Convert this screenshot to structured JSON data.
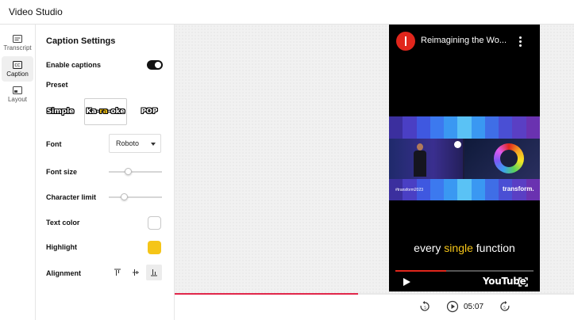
{
  "app": {
    "title": "Video Studio"
  },
  "rail": {
    "items": [
      {
        "label": "Transcript",
        "icon": "transcript-icon",
        "active": false
      },
      {
        "label": "Caption",
        "icon": "closed-caption-icon",
        "active": true
      },
      {
        "label": "Layout",
        "icon": "layout-icon",
        "active": false
      }
    ]
  },
  "panel": {
    "title": "Caption Settings",
    "enable_captions": {
      "label": "Enable captions",
      "on": true
    },
    "preset": {
      "label": "Preset",
      "options": [
        {
          "text": "Simple",
          "selected": false
        },
        {
          "parts": [
            "Ka-",
            "ra",
            "-oke"
          ],
          "selected": true
        },
        {
          "text": "POP",
          "selected": false
        }
      ]
    },
    "font": {
      "label": "Font",
      "value": "Roboto"
    },
    "font_size": {
      "label": "Font size",
      "fraction": 0.35
    },
    "character_limit": {
      "label": "Character limit",
      "fraction": 0.25
    },
    "text_color": {
      "label": "Text color",
      "color": "#ffffff"
    },
    "highlight": {
      "label": "Highlight",
      "color": "#f5c518"
    },
    "alignment": {
      "label": "Alignment",
      "options": [
        "align-top-icon",
        "align-middle-icon",
        "align-bottom-icon"
      ],
      "selected": 2
    }
  },
  "player": {
    "video_title": "Reimagining the Wo...",
    "frame_brand": "transform.",
    "frame_hashtag": "#transform2023",
    "caption": {
      "before": "every ",
      "highlight": "single",
      "after": " function"
    },
    "logo_text": "YouTube",
    "progress_fraction": 0.37
  },
  "timeline": {
    "progress_fraction": 0.46,
    "time": "05:07"
  },
  "colors": {
    "accent": "#e1264a",
    "highlight": "#f5c518",
    "brand_red": "#e1261c"
  }
}
